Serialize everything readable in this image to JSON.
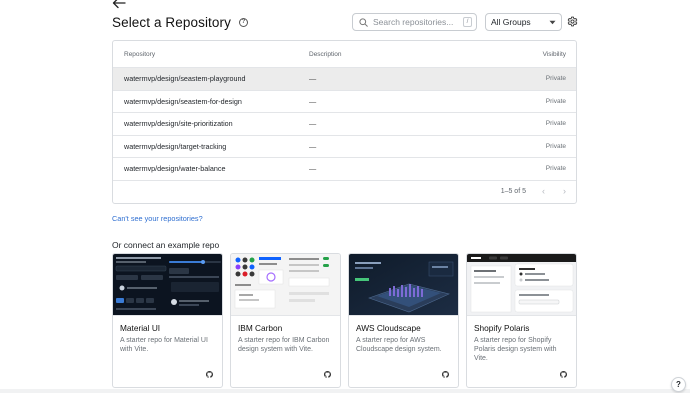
{
  "header": {
    "title": "Select a Repository",
    "search_placeholder": "Search repositories...",
    "search_shortcut": "/",
    "group_filter": "All Groups"
  },
  "table": {
    "columns": [
      "Repository",
      "Description",
      "Visibility"
    ],
    "rows": [
      {
        "repository": "watermvp/design/seastem-playground",
        "description": "—",
        "visibility": "Private"
      },
      {
        "repository": "watermvp/design/seastem-for-design",
        "description": "—",
        "visibility": "Private"
      },
      {
        "repository": "watermvp/design/site-prioritization",
        "description": "—",
        "visibility": "Private"
      },
      {
        "repository": "watermvp/design/target-tracking",
        "description": "—",
        "visibility": "Private"
      },
      {
        "repository": "watermvp/design/water-balance",
        "description": "—",
        "visibility": "Private"
      }
    ],
    "pagination": "1–5 of 5"
  },
  "cant_see_link": "Can't see your repositories?",
  "examples_heading": "Or connect an example repo",
  "examples": [
    {
      "name": "Material UI",
      "description": "A starter repo for Material UI with Vite."
    },
    {
      "name": "IBM Carbon",
      "description": "A starter repo for IBM Carbon design system with Vite."
    },
    {
      "name": "AWS Cloudscape",
      "description": "A starter repo for AWS Cloudscape design system."
    },
    {
      "name": "Shopify Polaris",
      "description": "A starter repo for Shopify Polaris design system with Vite."
    }
  ],
  "help_fab": "?",
  "colors": {
    "link": "#2f6fd1",
    "selected_row": "#ececec",
    "border": "#d9dce0"
  }
}
